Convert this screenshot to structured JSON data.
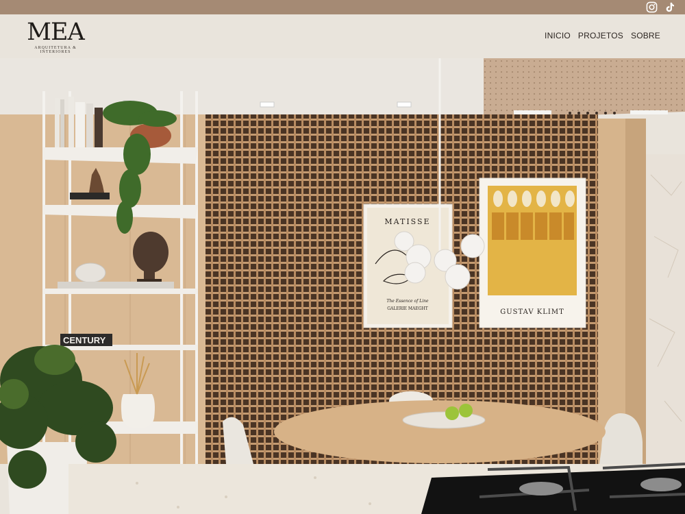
{
  "topbar": {
    "icons": [
      "instagram-icon",
      "tiktok-icon"
    ]
  },
  "header": {
    "logo_mark": "MEA",
    "logo_sub": "ARQUITETURA & INTERIORES"
  },
  "nav": {
    "items": [
      {
        "label": "INICIO"
      },
      {
        "label": "PROJETOS"
      },
      {
        "label": "SOBRE"
      }
    ]
  },
  "hero": {
    "poster_left": {
      "title": "MATISSE",
      "subtitle": "The Essence of Line",
      "footer": "GALERIE MAEGHT"
    },
    "poster_right": {
      "title": "GUSTAV KLIMT"
    },
    "book_spine": "CENTURY"
  },
  "colors": {
    "topbar": "#a58a74",
    "header_bg": "#e9e4dc",
    "nav_text": "#2b2420"
  }
}
